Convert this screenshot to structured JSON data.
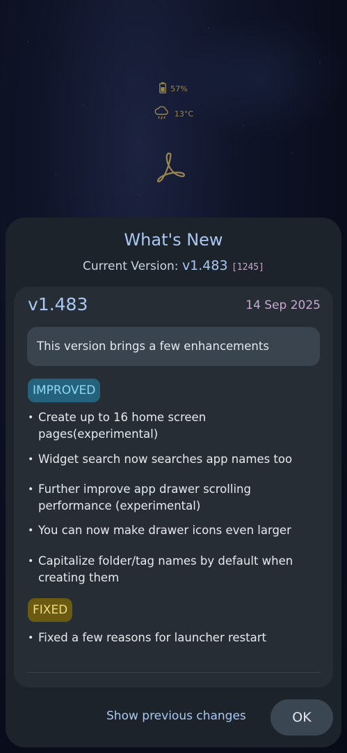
{
  "home": {
    "battery_text": "57%",
    "weather_text": "13°C"
  },
  "dialog": {
    "title": "What's New",
    "current_version_label": "Current Version:",
    "current_version": "v1.483",
    "build": "[1245]",
    "release": {
      "version": "v1.483",
      "date": "14 Sep 2025",
      "summary": "This version brings a few enhancements",
      "improved_label": "IMPROVED",
      "improved_items": [
        "Create up to 16 home screen pages(experimental)",
        "Widget search now searches app names too",
        "Further improve app drawer scrolling performance (experimental)",
        "You can now make drawer icons even larger",
        "Capitalize folder/tag names by default when creating them"
      ],
      "fixed_label": "FIXED",
      "fixed_items": [
        "Fixed a few reasons for launcher restart"
      ]
    },
    "show_previous_label": "Show previous changes",
    "ok_label": "OK"
  },
  "colors": {
    "accent": "#a9c8f3",
    "sheet_bg": "#1d232b",
    "improved_tag": "#25637c",
    "fixed_tag": "#6b5b12"
  }
}
